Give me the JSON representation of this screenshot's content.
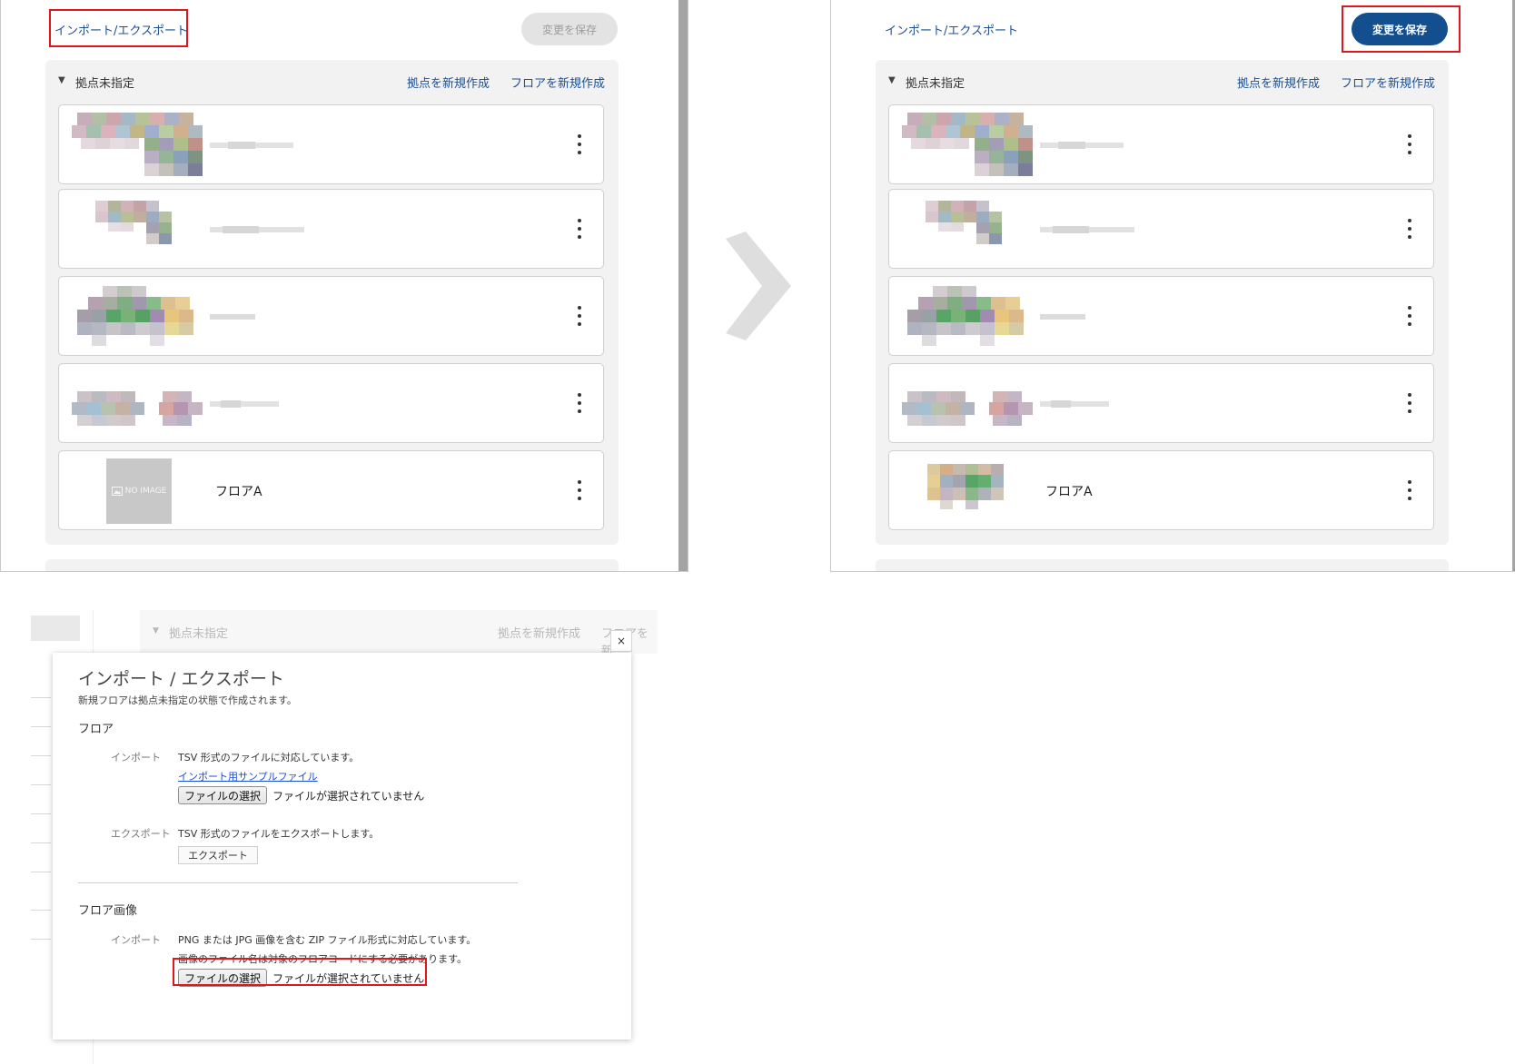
{
  "top_panel": {
    "import_export_link": "インポート/エクスポート",
    "save_button": "変更を保存",
    "group": {
      "title": "拠点未指定",
      "new_site_link": "拠点を新規作成",
      "new_floor_link": "フロアを新規作成"
    },
    "floors": [
      {
        "name": ""
      },
      {
        "name": ""
      },
      {
        "name": ""
      },
      {
        "name": ""
      },
      {
        "name": "フロアA"
      }
    ],
    "no_image_label": "NO IMAGE"
  },
  "dialog": {
    "background_group_title": "拠点未指定",
    "background_new_site_link": "拠点を新規作成",
    "background_new_floor_link": "フロアを新",
    "close_label": "×",
    "title": "インポート / エクスポート",
    "subtitle": "新規フロアは拠点未指定の状態で作成されます。",
    "floor_section": {
      "title": "フロア",
      "import_label": "インポート",
      "import_desc": "TSV 形式のファイルに対応しています。",
      "sample_link": "インポート用サンプルファイル",
      "file_button": "ファイルの選択",
      "file_status": "ファイルが選択されていません",
      "export_label": "エクスポート",
      "export_desc": "TSV 形式のファイルをエクスポートします。",
      "export_button": "エクスポート"
    },
    "image_section": {
      "title": "フロア画像",
      "import_label": "インポート",
      "import_desc_1": "PNG または JPG 画像を含む ZIP ファイル形式に対応しています。",
      "import_desc_2": "画像のファイル名は対象のフロアコードにする必要があります。",
      "file_button": "ファイルの選択",
      "file_status": "ファイルが選択されていません"
    }
  },
  "colors": {
    "accent_blue": "#134e8e",
    "link_blue": "#1d4f93",
    "highlight_red": "#e0161d",
    "disabled_gray": "#e3e3e3"
  }
}
